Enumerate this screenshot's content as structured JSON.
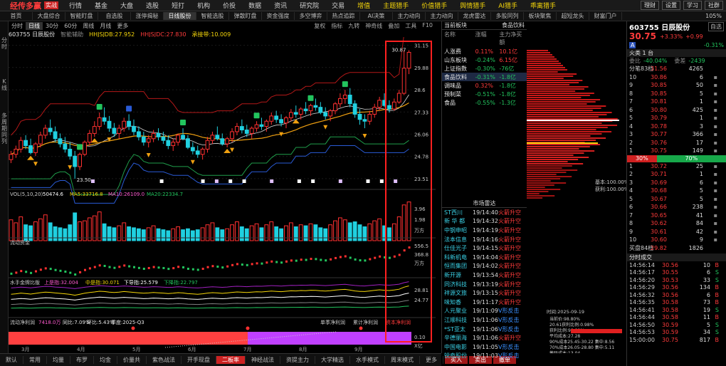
{
  "app": {
    "logo": "经传多赢",
    "badge": "实战",
    "menu": [
      "行情",
      "基金",
      "大盘",
      "选股",
      "短打",
      "机构",
      "价投",
      "数据",
      "资讯",
      "研究院",
      "交易",
      "增值",
      "主题猎手",
      "价值猎手",
      "舆情猎手",
      "AI猎手",
      "乖离猎手"
    ],
    "right_buttons": [
      "理财",
      "设置",
      "学习",
      "社群"
    ]
  },
  "tabs": [
    "首页",
    "大盘综合",
    "智能盯盘",
    "自选股",
    "涨停揭秘",
    "日线股份",
    "智能选股",
    "弹散盯盘",
    "资金强度",
    "多空博弈",
    "热点追踪",
    "AI决策",
    "主力动向",
    "主力动向",
    "龙虎雷达",
    "多股同列",
    "板块聚焦",
    "超短龙头",
    "财富门户"
  ],
  "selected_tab": 5,
  "zoom": "105%",
  "left_strip": [
    "分时",
    "K线",
    "多周期同列"
  ],
  "chart": {
    "periods": [
      "分时",
      "日线",
      "30分",
      "60分",
      "周线",
      "月线",
      "更多"
    ],
    "selected_period": 1,
    "tools": [
      "复权",
      "指标",
      "九转",
      "神奇线",
      "叠加",
      "工具",
      "F10"
    ],
    "stock_label": "603755 日辰股份",
    "indicator_label": "智能辅助",
    "hhjs_a": "HHJSJDB:27.952",
    "hhjs_b": "HHJSJDC:27.830",
    "hhjs_c": "承接带:10.009",
    "price_axis": [
      "31.15",
      "29.88",
      "28.6",
      "27.33",
      "26.06",
      "24.78",
      "23.51"
    ],
    "high_label": "30.87",
    "low_label": "23.50",
    "vol_label": "VOL(5,10,20)",
    "vol_val": "50474.6",
    "vol_ma5": "MA5:33716.8",
    "vol_ma10": "MA10:26109.0",
    "vol_ma20": "MA20:22334.7",
    "vol_axis": [
      "3.96",
      "1.98",
      "万方"
    ],
    "flow_label": "流动资金",
    "flow_axis": [
      "556.5",
      "368.8",
      "万方"
    ],
    "hand_label": "水手金牌比版",
    "hand_line_a": "上是指:32.004",
    "hand_line_b": "中是指:30.071",
    "hand_line_c": "下导指:25.579",
    "hand_line_d": "下降指:22.797",
    "hand_axis": [
      "28.81",
      "24.77"
    ],
    "fund_label": "流动净利润",
    "fund_vals": [
      "7418.0万",
      "同比:7.09%",
      "环比:5.43%",
      "季度:2025-Q3"
    ],
    "fund_right": [
      "单季净利润",
      "累计净利润",
      "资本净利润"
    ],
    "fund_axis": [
      "0.10",
      "X亿"
    ],
    "months": [
      "3月",
      "4月",
      "5月",
      "6月",
      "7月",
      "8月",
      "9月"
    ],
    "candles": [
      [
        24.6,
        25.1,
        24.4,
        24.9
      ],
      [
        24.9,
        25.4,
        24.7,
        25.2
      ],
      [
        25.2,
        25.9,
        25.0,
        25.7
      ],
      [
        25.7,
        26.0,
        25.2,
        25.4
      ],
      [
        25.4,
        25.8,
        24.9,
        25.0
      ],
      [
        25.0,
        25.6,
        24.8,
        25.5
      ],
      [
        25.5,
        26.2,
        25.3,
        26.0
      ],
      [
        26.0,
        26.6,
        25.8,
        26.4
      ],
      [
        26.4,
        26.9,
        26.0,
        26.2
      ],
      [
        26.2,
        26.5,
        25.6,
        25.8
      ],
      [
        25.8,
        26.1,
        25.3,
        25.5
      ],
      [
        25.5,
        25.9,
        25.0,
        25.2
      ],
      [
        25.2,
        25.6,
        24.6,
        24.8
      ],
      [
        24.8,
        25.1,
        23.5,
        24.2
      ],
      [
        24.2,
        25.0,
        24.0,
        24.9
      ],
      [
        24.9,
        25.7,
        24.8,
        25.6
      ],
      [
        25.6,
        26.3,
        25.4,
        26.1
      ],
      [
        26.1,
        26.8,
        25.9,
        26.5
      ],
      [
        26.5,
        27.3,
        26.3,
        27.0
      ],
      [
        27.0,
        27.6,
        26.6,
        26.8
      ],
      [
        26.8,
        27.1,
        26.2,
        26.4
      ],
      [
        26.4,
        26.7,
        25.9,
        26.1
      ],
      [
        26.1,
        26.6,
        25.8,
        26.4
      ],
      [
        26.4,
        27.0,
        26.2,
        26.8
      ],
      [
        26.8,
        27.2,
        26.3,
        26.5
      ],
      [
        26.5,
        26.9,
        26.0,
        26.2
      ],
      [
        26.2,
        26.5,
        25.7,
        25.9
      ],
      [
        25.9,
        26.2,
        25.4,
        25.6
      ],
      [
        25.6,
        26.0,
        25.3,
        25.8
      ],
      [
        25.8,
        26.3,
        25.6,
        26.1
      ],
      [
        26.1,
        26.4,
        25.7,
        25.9
      ],
      [
        25.9,
        26.2,
        25.5,
        25.7
      ],
      [
        25.7,
        26.0,
        25.2,
        25.4
      ],
      [
        25.4,
        25.8,
        25.1,
        25.6
      ],
      [
        25.6,
        26.1,
        25.4,
        26.0
      ],
      [
        26.0,
        26.4,
        25.7,
        25.8
      ],
      [
        25.8,
        26.0,
        25.2,
        25.3
      ],
      [
        25.3,
        25.6,
        24.9,
        25.1
      ],
      [
        25.1,
        25.4,
        24.7,
        24.9
      ],
      [
        24.9,
        25.3,
        24.6,
        25.2
      ],
      [
        25.2,
        25.9,
        25.0,
        25.7
      ],
      [
        25.7,
        26.2,
        25.5,
        26.0
      ],
      [
        26.0,
        26.5,
        25.7,
        25.8
      ],
      [
        25.8,
        26.1,
        25.4,
        25.5
      ],
      [
        25.5,
        25.9,
        25.3,
        25.8
      ],
      [
        25.8,
        26.4,
        25.6,
        26.2
      ],
      [
        26.2,
        26.7,
        26.0,
        26.5
      ],
      [
        26.5,
        26.9,
        26.1,
        26.3
      ],
      [
        26.3,
        26.6,
        25.9,
        26.1
      ],
      [
        26.1,
        26.5,
        25.8,
        26.4
      ],
      [
        26.4,
        26.8,
        26.2,
        26.6
      ],
      [
        26.6,
        27.0,
        26.3,
        26.5
      ],
      [
        26.5,
        26.9,
        26.2,
        26.8
      ],
      [
        26.8,
        27.3,
        26.6,
        27.1
      ],
      [
        27.1,
        27.4,
        26.7,
        26.9
      ],
      [
        26.9,
        27.2,
        26.5,
        26.7
      ],
      [
        26.7,
        27.1,
        26.4,
        27.0
      ],
      [
        27.0,
        27.5,
        26.8,
        27.3
      ],
      [
        27.3,
        27.7,
        27.0,
        27.2
      ],
      [
        27.2,
        27.6,
        26.9,
        27.5
      ],
      [
        27.5,
        27.9,
        27.2,
        27.4
      ],
      [
        27.4,
        27.8,
        27.1,
        27.7
      ],
      [
        27.7,
        28.1,
        27.4,
        27.6
      ],
      [
        27.6,
        27.9,
        27.2,
        27.3
      ],
      [
        27.3,
        27.6,
        26.9,
        27.1
      ],
      [
        27.1,
        27.5,
        26.8,
        27.4
      ],
      [
        27.4,
        27.9,
        27.2,
        27.8
      ],
      [
        27.8,
        28.4,
        27.6,
        28.1
      ],
      [
        28.1,
        28.6,
        27.8,
        28.3
      ],
      [
        28.3,
        28.7,
        27.6,
        27.8
      ],
      [
        27.8,
        28.0,
        27.0,
        27.2
      ],
      [
        27.2,
        27.5,
        26.6,
        26.9
      ],
      [
        26.9,
        27.2,
        26.4,
        26.8
      ],
      [
        26.8,
        27.4,
        26.6,
        27.2
      ],
      [
        27.2,
        27.8,
        27.0,
        27.6
      ],
      [
        27.6,
        28.2,
        27.4,
        28.0
      ],
      [
        28.0,
        28.4,
        27.6,
        27.7
      ],
      [
        27.7,
        28.0,
        27.3,
        27.5
      ],
      [
        27.5,
        28.1,
        27.4,
        27.9
      ],
      [
        27.9,
        28.6,
        27.8,
        28.4
      ],
      [
        28.4,
        30.87,
        28.3,
        29.84
      ],
      [
        29.84,
        30.87,
        29.5,
        30.75
      ]
    ],
    "volumes": [
      2.1,
      1.8,
      2.4,
      1.6,
      1.5,
      1.9,
      2.2,
      2.6,
      1.8,
      1.4,
      1.3,
      1.2,
      1.6,
      2.8,
      1.9,
      2.0,
      2.3,
      2.5,
      2.9,
      1.7,
      1.4,
      1.3,
      1.5,
      1.8,
      1.4,
      1.3,
      1.2,
      1.1,
      1.3,
      1.5,
      1.2,
      1.1,
      1.0,
      1.2,
      1.4,
      1.1,
      1.2,
      1.0,
      1.1,
      1.3,
      1.6,
      1.8,
      1.3,
      1.1,
      1.2,
      1.6,
      1.9,
      1.4,
      1.2,
      1.5,
      1.7,
      1.3,
      1.6,
      1.9,
      1.4,
      1.2,
      1.5,
      1.8,
      1.4,
      1.6,
      1.5,
      1.7,
      1.6,
      1.3,
      1.2,
      1.6,
      2.0,
      2.3,
      2.1,
      1.8,
      1.9,
      1.6,
      1.4,
      1.7,
      2.0,
      2.2,
      1.5,
      1.3,
      1.7,
      2.4,
      3.6,
      3.9
    ]
  },
  "sector": {
    "header_left": "当前板块",
    "header_right": "食品饮料",
    "cols": [
      "名称",
      "涨幅",
      "主力净买额"
    ],
    "rows": [
      {
        "name": "人涨费",
        "pct": "0.11%",
        "amt": "10.1亿",
        "up": true
      },
      {
        "name": "山东板块",
        "pct": "-0.24%",
        "amt": "6.15亿",
        "up": false
      },
      {
        "name": "上证指数",
        "pct": "-0.30%",
        "amt": "-76亿",
        "up": false
      },
      {
        "name": "食品饮料",
        "pct": "-0.31%",
        "amt": "-1.8亿",
        "up": false,
        "sel": true
      },
      {
        "name": "调味品",
        "pct": "0.32%",
        "amt": "-1.8亿",
        "up": true
      },
      {
        "name": "预制菜",
        "pct": "-0.51%",
        "amt": "-1.8亿",
        "up": false
      },
      {
        "name": "食品",
        "pct": "-0.55%",
        "amt": "-1.3亿",
        "up": false
      }
    ]
  },
  "radar": {
    "title": "市场雷达",
    "rows": [
      {
        "name": "ST西川",
        "time": "19/14:40",
        "ev": "火箭升空",
        "g": false
      },
      {
        "name": "新 华 都",
        "time": "19/14:32",
        "ev": "火箭升空",
        "g": false
      },
      {
        "name": "中钢申昭",
        "time": "19/14:19",
        "ev": "火箭升空",
        "g": false
      },
      {
        "name": "法本信息",
        "time": "19/14:16",
        "ev": "火箭升空",
        "g": false
      },
      {
        "name": "仕佳光子",
        "time": "19/14:15",
        "ev": "火箭升空",
        "g": false
      },
      {
        "name": "科新机电",
        "time": "19/14:04",
        "ev": "火箭升空",
        "g": false
      },
      {
        "name": "恒而集团",
        "time": "19/14:02",
        "ev": "火箭升空",
        "g": false
      },
      {
        "name": "新开源",
        "time": "19/13:54",
        "ev": "火箭升空",
        "g": false
      },
      {
        "name": "同济科技",
        "time": "19/13:19",
        "ev": "火箭升空",
        "g": false
      },
      {
        "name": "祥源文旅",
        "time": "19/13:15",
        "ev": "火箭升空",
        "g": false
      },
      {
        "name": "味知香",
        "time": "19/11:17",
        "ev": "火箭升空",
        "g": false
      },
      {
        "name": "人元聚业",
        "time": "19/11:09",
        "ev": "V形反击",
        "g": true
      },
      {
        "name": "江顺科技",
        "time": "19/11:06",
        "ev": "V形反击",
        "g": true
      },
      {
        "name": "*ST亚太",
        "time": "19/11:06",
        "ev": "V形反击",
        "g": true
      },
      {
        "name": "辛德丽海",
        "time": "19/11:06",
        "ev": "火箭升空",
        "g": false
      },
      {
        "name": "中国电影",
        "time": "19/11:05",
        "ev": "V形反击",
        "g": true
      },
      {
        "name": "锐奇股份",
        "time": "19/11:03",
        "ev": "V形反击",
        "g": true
      }
    ]
  },
  "profile": {
    "label_a": "基本:100.00%",
    "label_b": "获利:100.00%",
    "date": "时间:2025-09-19",
    "info": [
      "当前价:98.80%",
      "20.61获利比例:0.98%",
      "获利比例:98.80%",
      "平均成本:27.28",
      "90%成本25.45-30.22 集中:8.56",
      "70%成本26.05-28.80 集中:5.11",
      "筹码成本:13.04"
    ]
  },
  "quote": {
    "code": "603755 日辰股份",
    "selfsel": "自选",
    "price": "30.75",
    "chg_pct": "+3.33%",
    "chg": "+0.99",
    "a_label": "A",
    "sub_right": "-0.31%",
    "level_label": "火类 1 台",
    "wei_bi": "委比",
    "wei_bi_val": "-40.04%",
    "wei_cha": "委差",
    "wei_cha_val": "-2439",
    "last_row": {
      "l": "分笔83档",
      "p": "31.56",
      "v": "4265"
    },
    "asks": [
      {
        "l": "10",
        "p": "30.86",
        "v": "6"
      },
      {
        "l": "9",
        "p": "30.85",
        "v": "50"
      },
      {
        "l": "8",
        "p": "30.85",
        "v": "5"
      },
      {
        "l": "7",
        "p": "30.81",
        "v": "1"
      },
      {
        "l": "6",
        "p": "30.80",
        "v": "425"
      },
      {
        "l": "5",
        "p": "30.79",
        "v": "1"
      },
      {
        "l": "4",
        "p": "30.78",
        "v": "3"
      },
      {
        "l": "3",
        "p": "30.77",
        "v": "366"
      },
      {
        "l": "2",
        "p": "30.76",
        "v": "17"
      },
      {
        "l": "1",
        "p": "30.75",
        "v": "149"
      }
    ],
    "ratio_left": "30%",
    "ratio_right": "70%",
    "bids": [
      {
        "l": "1",
        "p": "30.72",
        "v": "25"
      },
      {
        "l": "2",
        "p": "30.71",
        "v": "1"
      },
      {
        "l": "3",
        "p": "30.69",
        "v": "6"
      },
      {
        "l": "4",
        "p": "30.68",
        "v": "5"
      },
      {
        "l": "5",
        "p": "30.67",
        "v": "5"
      },
      {
        "l": "6",
        "p": "30.66",
        "v": "238"
      },
      {
        "l": "7",
        "p": "30.65",
        "v": "41"
      },
      {
        "l": "8",
        "p": "30.62",
        "v": "84"
      },
      {
        "l": "9",
        "p": "30.61",
        "v": "42"
      },
      {
        "l": "10",
        "p": "30.60",
        "v": "9"
      }
    ],
    "bottom_row": {
      "l": "买盘84档",
      "p": "29.82",
      "v": "1826"
    },
    "ticks_title": "分时成交",
    "ticks": [
      {
        "t": "14:56:14",
        "p": "30.56",
        "v": "10",
        "s": "B"
      },
      {
        "t": "14:56:17",
        "p": "30.55",
        "v": "6",
        "s": "S"
      },
      {
        "t": "14:56:20",
        "p": "30.53",
        "v": "33",
        "s": "S"
      },
      {
        "t": "14:56:29",
        "p": "30.56",
        "v": "134",
        "s": "B"
      },
      {
        "t": "14:56:32",
        "p": "30.56",
        "v": "6",
        "s": "B"
      },
      {
        "t": "14:56:35",
        "p": "30.58",
        "v": "73",
        "s": "B"
      },
      {
        "t": "14:56:41",
        "p": "30.58",
        "v": "19",
        "s": "S"
      },
      {
        "t": "14:56:44",
        "p": "30.58",
        "v": "11",
        "s": "B"
      },
      {
        "t": "14:56:50",
        "p": "30.59",
        "v": "5",
        "s": "S"
      },
      {
        "t": "14:56:53",
        "p": "30.59",
        "v": "34",
        "s": "S"
      },
      {
        "t": "15:00:00",
        "p": "30.75",
        "v": "817",
        "s": "B"
      }
    ]
  },
  "bottom_tabs": [
    "默认",
    "常用",
    "均量",
    "布罗",
    "均金",
    "价量共",
    "紫色战法",
    "开手现盘",
    "二板率",
    "神经战法",
    "资提主力",
    "大学精选",
    "水手模式",
    "周末模式",
    "更多"
  ],
  "bottom_selected": 8,
  "trade_buttons": [
    "买入",
    "卖出",
    "撤单"
  ]
}
